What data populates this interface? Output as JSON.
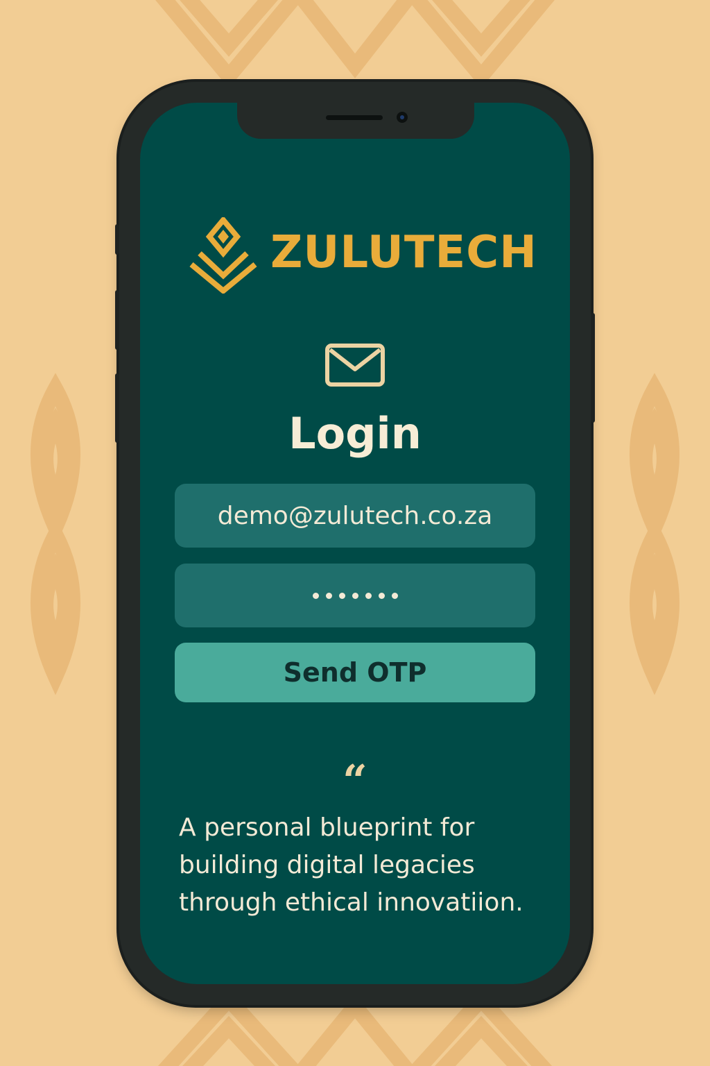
{
  "colors": {
    "background": "#f2cd94",
    "pattern": "#e9ba7a",
    "phone_frame": "#252a28",
    "screen": "#004b47",
    "brand_accent": "#e9ac3a",
    "input_fill": "#1f6f6c",
    "button_fill": "#4aab9b",
    "text_light": "#f3ead6"
  },
  "brand": {
    "name": "ZULUTECH",
    "logo_icon": "zulu-shield-chevron-icon"
  },
  "login": {
    "icon": "envelope-icon",
    "title": "Login",
    "email_value": "demo@zulutech.co.za",
    "password_mask": "•••••••",
    "send_button_label": "Send OTP"
  },
  "quote": {
    "mark": "“",
    "text": "A personal blueprint for building digital legacies through ethical innovatiion."
  }
}
